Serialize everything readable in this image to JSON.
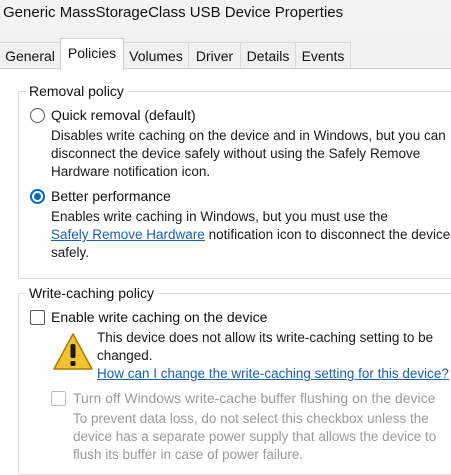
{
  "window": {
    "title": "Generic MassStorageClass USB Device Properties"
  },
  "tabs": [
    {
      "label": "General",
      "active": false
    },
    {
      "label": "Policies",
      "active": true
    },
    {
      "label": "Volumes",
      "active": false
    },
    {
      "label": "Driver",
      "active": false
    },
    {
      "label": "Details",
      "active": false
    },
    {
      "label": "Events",
      "active": false
    }
  ],
  "removal_policy": {
    "title": "Removal policy",
    "quick_removal": {
      "label": "Quick removal (default)",
      "selected": false,
      "description_lines": [
        "Disables write caching on the device and in Windows, but you can",
        "disconnect the device safely without using the Safely Remove",
        "Hardware notification icon."
      ]
    },
    "better_performance": {
      "label": "Better performance",
      "selected": true,
      "description_line1": "Enables write caching in Windows, but you must use the",
      "link_text": "Safely Remove Hardware",
      "description_line2_rest": " notification icon to disconnect the device",
      "description_line3": "safely."
    }
  },
  "write_caching_policy": {
    "title": "Write-caching policy",
    "enable_write_caching": {
      "label": "Enable write caching on the device",
      "checked": false
    },
    "warning": {
      "icon": "warning-icon",
      "line1": "This device does not allow its write-caching setting to be",
      "line2": "changed.",
      "link_text": "How can I change the write-caching setting for this device?"
    },
    "turn_off_flushing": {
      "label": "Turn off Windows write-cache buffer flushing on the device",
      "checked": false,
      "enabled": false,
      "description_lines": [
        "To prevent data loss, do not select this checkbox unless the",
        "device has a separate power supply that allows the device to",
        "flush its buffer in case of power failure."
      ]
    }
  },
  "colors": {
    "accent": "#0067c0",
    "link": "#1a5fb4",
    "disabled_text": "#9a9a9a",
    "warning_yellow": "#f2c230"
  }
}
